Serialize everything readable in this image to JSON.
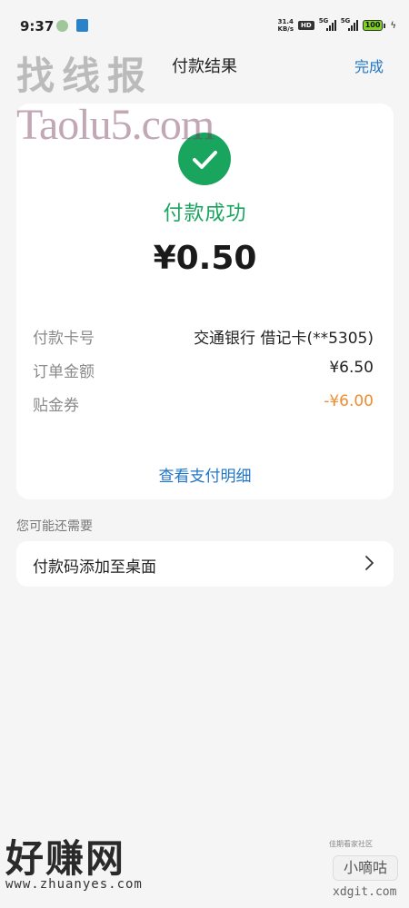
{
  "status_bar": {
    "time": "9:37",
    "net_speed_value": "31.4",
    "net_speed_unit": "KB/s",
    "hd_badge": "HD",
    "sim1_label": "5G",
    "sim2_label": "5G",
    "battery": "100",
    "icons": [
      "wechat-icon",
      "app-notification-icon",
      "signal-icon",
      "battery-icon",
      "charging-icon"
    ]
  },
  "nav": {
    "title": "付款结果",
    "done_label": "完成"
  },
  "result": {
    "status": "付款成功",
    "amount": "¥0.50",
    "success_color": "#1aa55f",
    "rows": [
      {
        "key": "付款卡号",
        "value": "交通银行 借记卡(**5305)"
      },
      {
        "key": "订单金额",
        "value": "¥6.50"
      },
      {
        "key": "贴金券",
        "value": "-¥6.00"
      }
    ],
    "detail_link": "查看支付明细"
  },
  "suggestions": {
    "section_label": "您可能还需要",
    "items": [
      {
        "label": "付款码添加至桌面"
      }
    ]
  },
  "watermarks": {
    "top_cn": "找线报",
    "top_en": "Taolu5.com",
    "bottom_cn": "好赚网",
    "bottom_url": "www.zhuanyes.com",
    "corner_small": "佳期看家社区",
    "corner_logo": "小嘀咕",
    "corner_url": "xdgit.com"
  },
  "colors": {
    "accent_blue": "#2176c6",
    "discount_orange": "#f08c2e",
    "background": "#f5f5f5"
  }
}
